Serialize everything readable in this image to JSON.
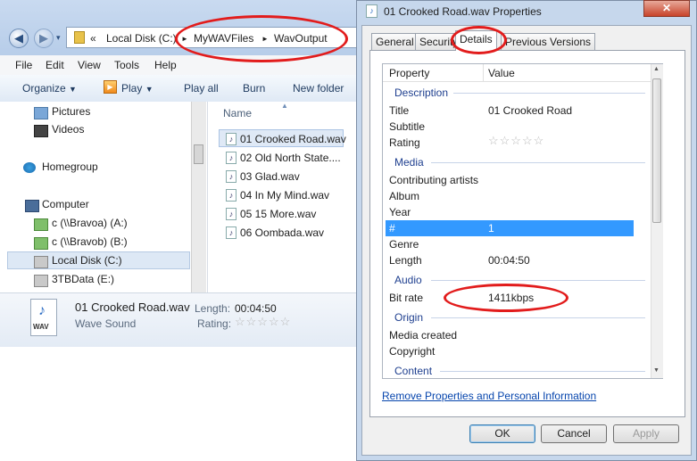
{
  "explorer": {
    "address": {
      "back_arrow": "«",
      "segments": [
        "Local Disk (C:)",
        "MyWAVFiles",
        "WavOutput"
      ],
      "separator": "►"
    },
    "menu": [
      "File",
      "Edit",
      "View",
      "Tools",
      "Help"
    ],
    "toolbar": {
      "organize": "Organize",
      "play": "Play",
      "play_all": "Play all",
      "burn": "Burn",
      "new_folder": "New folder"
    },
    "nav": {
      "pictures": "Pictures",
      "videos": "Videos",
      "homegroup": "Homegroup",
      "computer": "Computer",
      "drive_a": "c (\\\\Bravoa) (A:)",
      "drive_b": "c (\\\\Bravob) (B:)",
      "local_disk": "Local Disk (C:)",
      "drive_e": "3TBData (E:)"
    },
    "files": {
      "column_header": "Name",
      "items": [
        "01 Crooked Road.wav",
        "02 Old North State....",
        "03 Glad.wav",
        "04 In My Mind.wav",
        "05 15 More.wav",
        "06 Oombada.wav"
      ]
    },
    "details": {
      "file_name": "01 Crooked Road.wav",
      "file_type": "Wave Sound",
      "length_label": "Length:",
      "length_value": "00:04:50",
      "rating_label": "Rating:",
      "icon_text": "WAV"
    }
  },
  "properties": {
    "title": "01 Crooked Road.wav Properties",
    "close": "✕",
    "tabs": [
      "General",
      "Security",
      "Details",
      "Previous Versions"
    ],
    "active_tab": "Details",
    "grid": {
      "col_property": "Property",
      "col_value": "Value",
      "groups": {
        "description": "Description",
        "media": "Media",
        "audio": "Audio",
        "origin": "Origin",
        "content": "Content"
      },
      "rows": {
        "title": {
          "label": "Title",
          "value": "01 Crooked Road"
        },
        "subtitle": {
          "label": "Subtitle",
          "value": ""
        },
        "rating": {
          "label": "Rating",
          "value": ""
        },
        "contributing_artists": {
          "label": "Contributing artists",
          "value": ""
        },
        "album": {
          "label": "Album",
          "value": ""
        },
        "year": {
          "label": "Year",
          "value": ""
        },
        "track": {
          "label": "#",
          "value": "1"
        },
        "genre": {
          "label": "Genre",
          "value": ""
        },
        "length": {
          "label": "Length",
          "value": "00:04:50"
        },
        "bit_rate": {
          "label": "Bit rate",
          "value": "1411kbps"
        },
        "media_created": {
          "label": "Media created",
          "value": ""
        },
        "copyright": {
          "label": "Copyright",
          "value": ""
        }
      }
    },
    "remove_link": "Remove Properties and Personal Information",
    "buttons": {
      "ok": "OK",
      "cancel": "Cancel",
      "apply": "Apply"
    }
  },
  "colors": {
    "annotation_oval": "#e21c1c",
    "selection": "#3399ff",
    "group_label": "#1e3f8f"
  }
}
